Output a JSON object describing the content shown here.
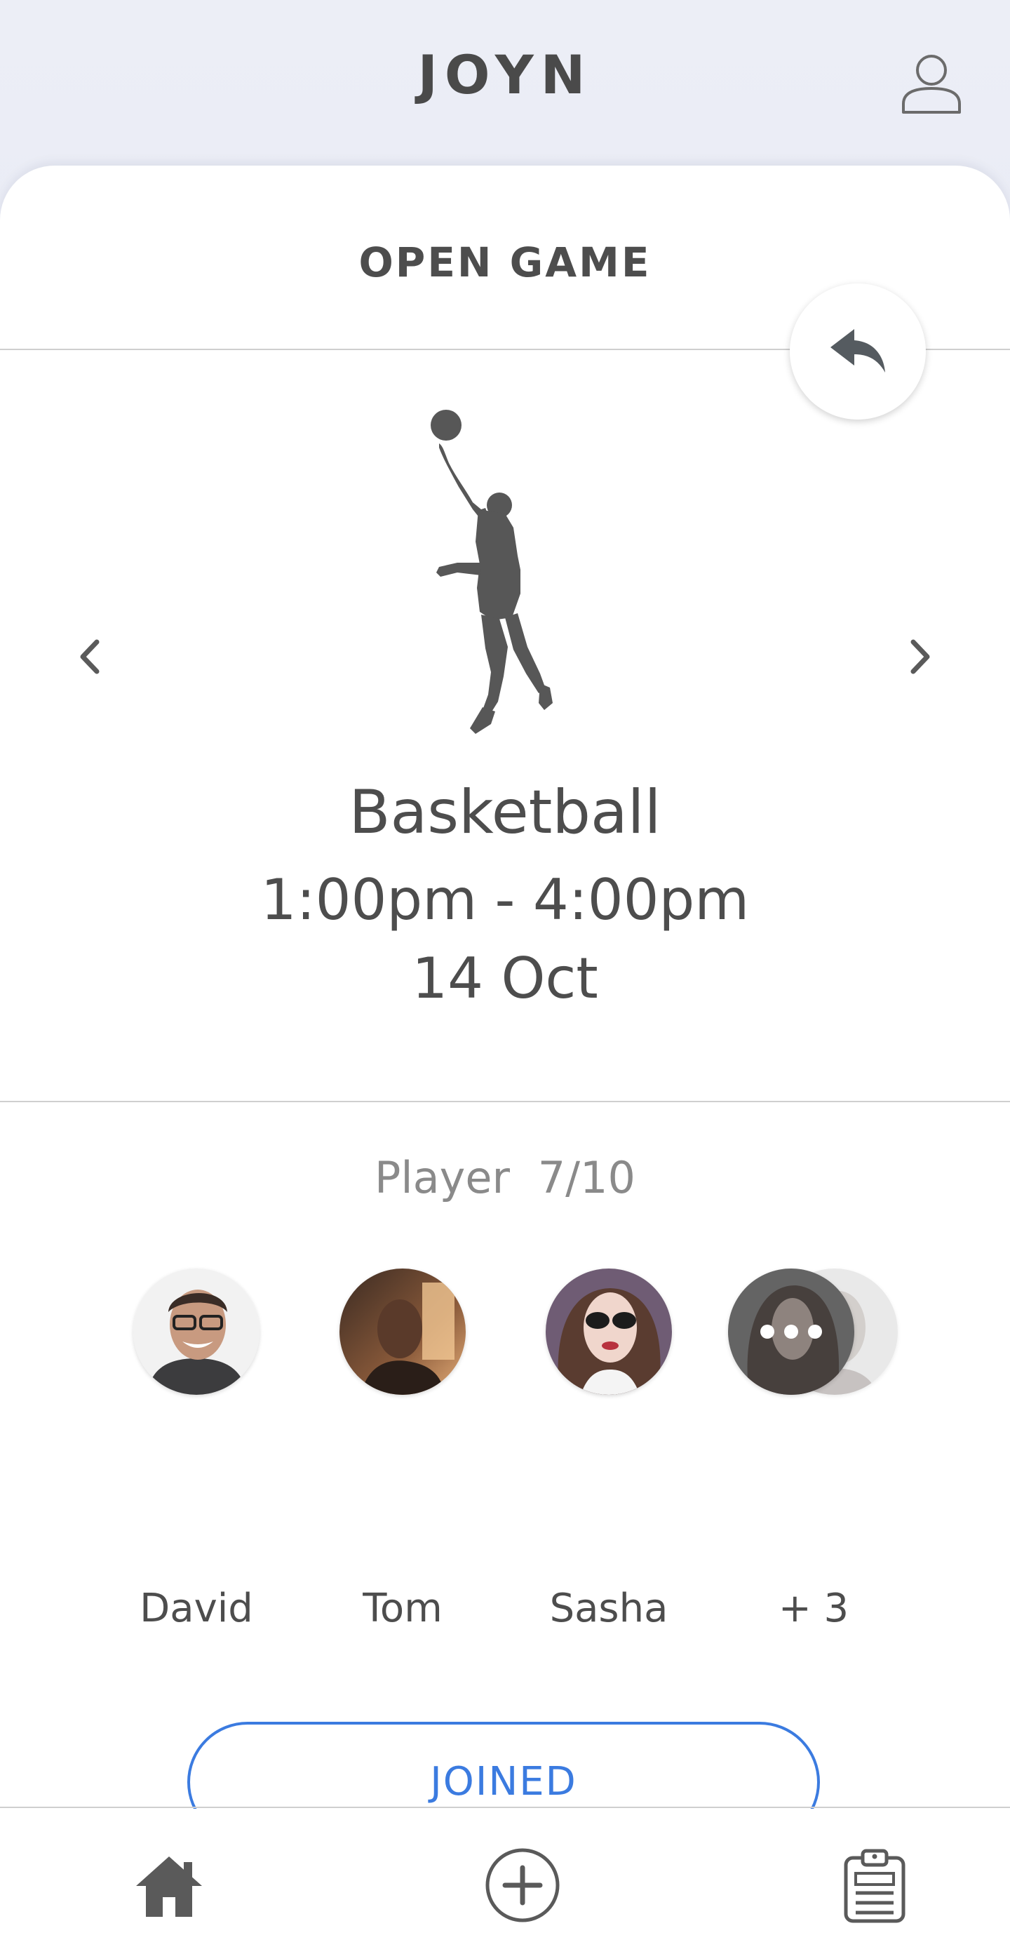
{
  "app": {
    "title": "JOYN"
  },
  "card": {
    "title": "OPEN GAME"
  },
  "game": {
    "sport": "Basketball",
    "time": "1:00pm - 4:00pm",
    "date": "14 Oct"
  },
  "players": {
    "label": "Player",
    "count": "7/10",
    "list": [
      {
        "name": "David"
      },
      {
        "name": "Tom"
      },
      {
        "name": "Sasha"
      },
      {
        "name": "+ 3"
      }
    ]
  },
  "actions": {
    "joined_label": "JOINED"
  },
  "icons": {
    "profile": "user-icon",
    "back": "reply-icon",
    "prev": "chevron-left-icon",
    "next": "chevron-right-icon",
    "home": "home-icon",
    "create": "plus-circle-icon",
    "list": "clipboard-icon"
  },
  "colors": {
    "accent": "#3b7be0",
    "text": "#4d4d4d",
    "muted": "#8a8a8a"
  }
}
